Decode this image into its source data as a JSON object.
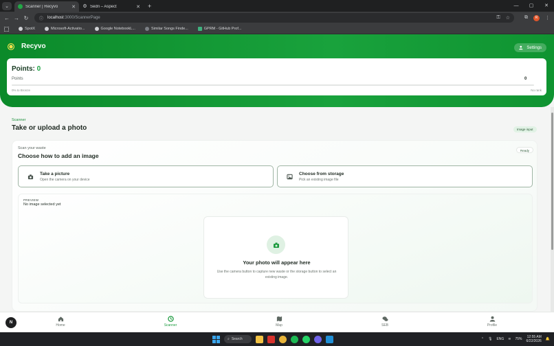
{
  "browser": {
    "tabs": [
      {
        "title": "Scanner | Recyvo",
        "active": true
      },
      {
        "title": "Sedri – Aspect",
        "active": false
      }
    ],
    "url_host": "localhost",
    "url_path": ":3000/ScannerPage",
    "bookmarks": [
      "SpotX",
      "Microsoft-Activatio...",
      "Google NotebookL...",
      "Similar Songs Finde...",
      "GPRM - GitHub Prof..."
    ],
    "profile_letter": "R"
  },
  "app": {
    "brand": "Recyvo",
    "settings_label": "Settings",
    "points": {
      "title_prefix": "Points:",
      "value": "0",
      "label": "Points",
      "count": "0",
      "progress_fraction": 0,
      "progress_left": "0% to Bronze",
      "progress_right": "No rank"
    },
    "scanner": {
      "eyebrow": "Scanner",
      "title": "Take or upload a photo",
      "chip": "Image input",
      "card_sub": "Scan your waste",
      "card_title": "Choose how to add an image",
      "status": "Ready",
      "options": {
        "camera": {
          "title": "Take a picture",
          "desc": "Open the camera on your device",
          "icon": "camera-icon"
        },
        "storage": {
          "title": "Choose from storage",
          "desc": "Pick an existing image file",
          "icon": "image-icon"
        }
      },
      "preview": {
        "label": "PREVIEW",
        "state": "No image selected yet",
        "placeholder_title": "Your photo will appear here",
        "placeholder_desc": "Use the camera button to capture new waste or the storage button to select an existing image."
      }
    },
    "nav": [
      {
        "label": "Home",
        "icon": "home-icon",
        "active": false
      },
      {
        "label": "Scanner",
        "icon": "scanner-icon",
        "active": true
      },
      {
        "label": "Map",
        "icon": "map-icon",
        "active": false
      },
      {
        "label": "SEB",
        "icon": "chat-icon",
        "active": false
      },
      {
        "label": "Profile",
        "icon": "profile-icon",
        "active": false
      }
    ],
    "fab_label": "N"
  },
  "taskbar": {
    "search_label": "Search",
    "lang": "ENG",
    "battery": "75%",
    "time": "12:55 AM",
    "date": "6/22/2026"
  },
  "colors": {
    "brand_green": "#19a23c",
    "accent": "#1ea344"
  }
}
